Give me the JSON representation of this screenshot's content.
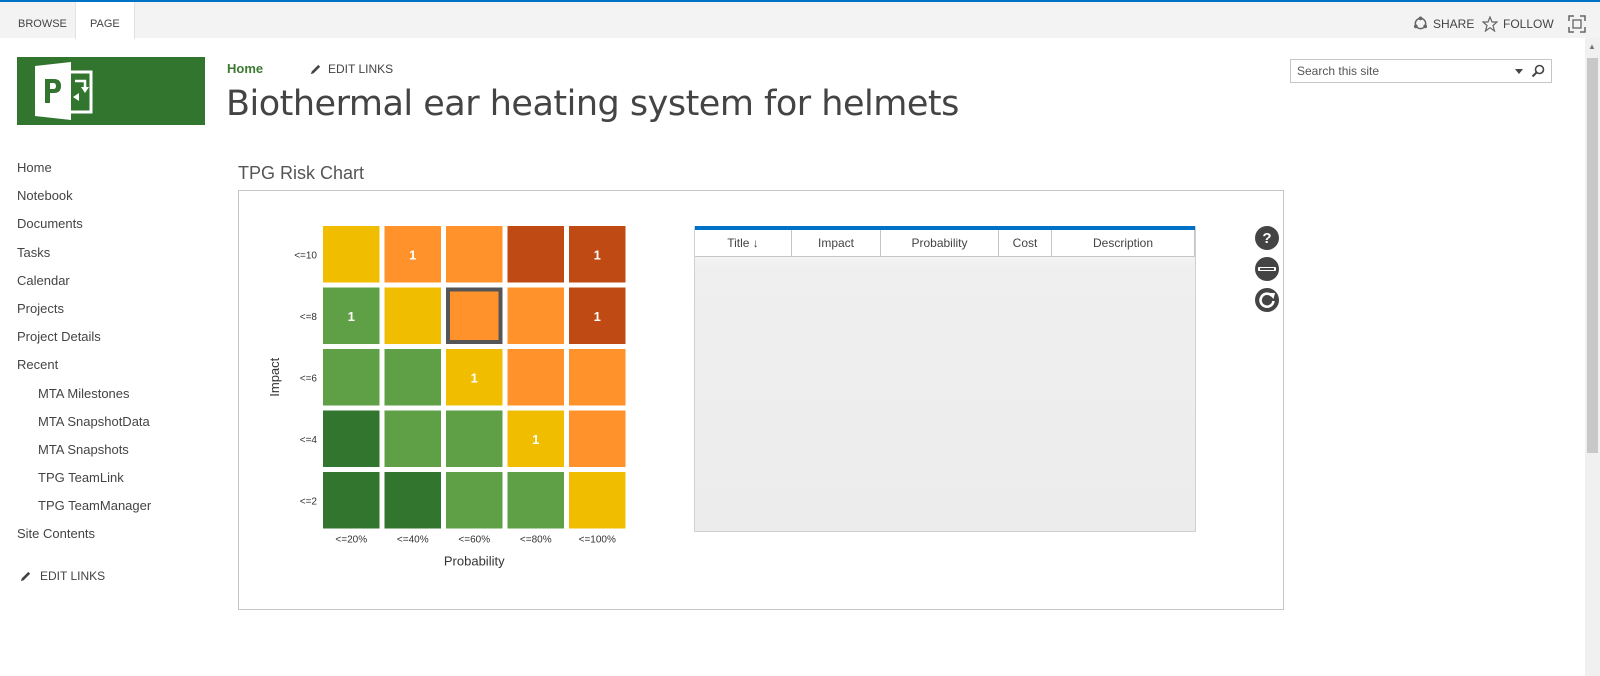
{
  "ribbon": {
    "tabs": [
      "BROWSE",
      "PAGE"
    ],
    "share_label": "SHARE",
    "follow_label": "FOLLOW"
  },
  "header": {
    "breadcrumb_home": "Home",
    "edit_links": "EDIT LINKS",
    "site_title": "Biothermal ear heating system for helmets"
  },
  "search": {
    "placeholder": "Search this site"
  },
  "leftnav": {
    "items": [
      {
        "label": "Home",
        "sub": false
      },
      {
        "label": "Notebook",
        "sub": false
      },
      {
        "label": "Documents",
        "sub": false
      },
      {
        "label": "Tasks",
        "sub": false
      },
      {
        "label": "Calendar",
        "sub": false
      },
      {
        "label": "Projects",
        "sub": false
      },
      {
        "label": "Project Details",
        "sub": false
      },
      {
        "label": "Recent",
        "sub": false
      },
      {
        "label": "MTA Milestones",
        "sub": true
      },
      {
        "label": "MTA SnapshotData",
        "sub": true
      },
      {
        "label": "MTA Snapshots",
        "sub": true
      },
      {
        "label": "TPG TeamLink",
        "sub": true
      },
      {
        "label": "TPG TeamManager",
        "sub": true
      },
      {
        "label": "Site Contents",
        "sub": false
      }
    ],
    "edit_links": "EDIT LINKS"
  },
  "webpart": {
    "title": "TPG Risk Chart"
  },
  "colors": {
    "dark_green": "#31752f",
    "green": "#5fa046",
    "yellow": "#f0bd00",
    "orange": "#ff922b",
    "red": "#c04a13",
    "accent_blue": "#0072c6"
  },
  "chart_data": {
    "type": "heatmap",
    "xlabel": "Probability",
    "ylabel": "Impact",
    "x_categories": [
      "<=20%",
      "<=40%",
      "<=60%",
      "<=80%",
      "<=100%"
    ],
    "y_categories": [
      "<=10",
      "<=8",
      "<=6",
      "<=4",
      "<=2"
    ],
    "cells": [
      [
        "yellow",
        "orange",
        "orange",
        "red",
        "red"
      ],
      [
        "green",
        "yellow",
        "orange",
        "orange",
        "red"
      ],
      [
        "green",
        "green",
        "yellow",
        "orange",
        "orange"
      ],
      [
        "dark_green",
        "green",
        "green",
        "yellow",
        "orange"
      ],
      [
        "dark_green",
        "dark_green",
        "green",
        "green",
        "yellow"
      ]
    ],
    "counts": [
      [
        null,
        1,
        null,
        null,
        1
      ],
      [
        1,
        null,
        null,
        null,
        1
      ],
      [
        null,
        null,
        1,
        null,
        null
      ],
      [
        null,
        null,
        null,
        1,
        null
      ],
      [
        null,
        null,
        null,
        null,
        null
      ]
    ],
    "selected_cell": {
      "row": 1,
      "col": 2
    }
  },
  "grid": {
    "columns": [
      "Title ↓",
      "Impact",
      "Probability",
      "Cost",
      "Description"
    ],
    "rows": []
  }
}
